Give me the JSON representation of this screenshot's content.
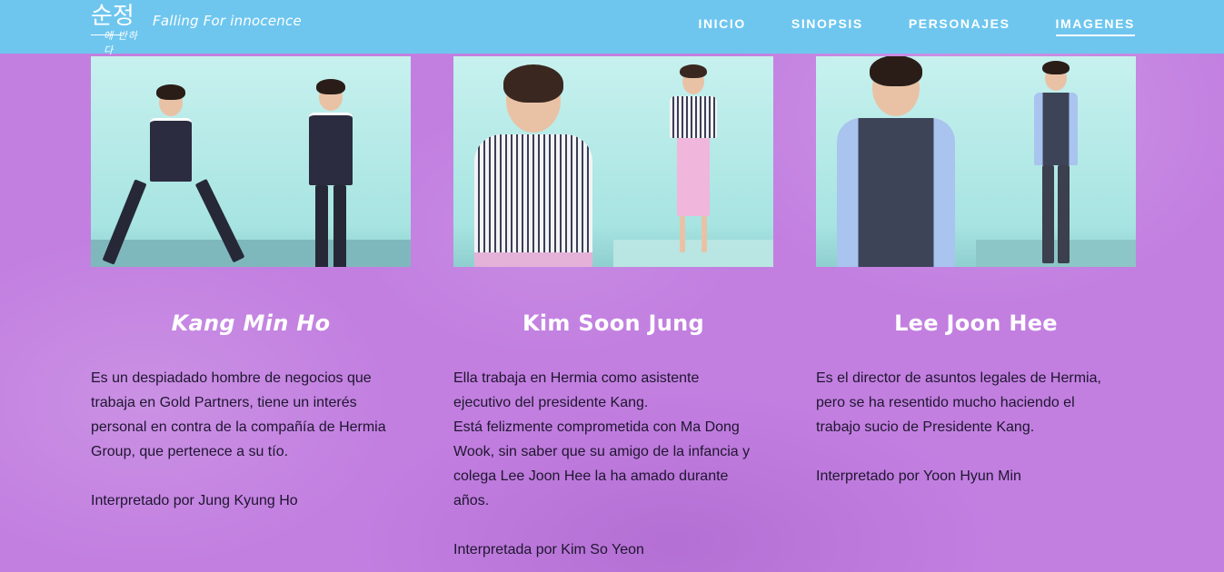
{
  "header": {
    "logo_korean": "순정",
    "logo_korean_small": "에 반하다",
    "logo_title": "Falling For innocence",
    "nav": [
      {
        "label": "INICIO"
      },
      {
        "label": "SINOPSIS"
      },
      {
        "label": "PERSONAJES"
      },
      {
        "label": "IMAGENES"
      }
    ],
    "active_nav": "IMAGENES"
  },
  "characters": [
    {
      "name": "Kang Min Ho",
      "description": [
        "Es un despiadado hombre de negocios que",
        "trabaja en Gold Partners, tiene un interés",
        "personal en contra de la compañía de Hermia",
        "Group, que pertenece a su tío."
      ],
      "actor": "Interpretado por Jung Kyung Ho"
    },
    {
      "name": "Kim Soon Jung",
      "description": [
        "Ella trabaja en Hermia como asistente",
        "ejecutivo del presidente Kang.",
        "Está felizmente comprometida con Ma Dong",
        "Wook, sin saber que su amigo de la infancia y",
        "colega Lee Joon Hee la ha amado durante",
        "años."
      ],
      "actor": "Interpretada por Kim So Yeon"
    },
    {
      "name": "Lee Joon Hee",
      "description": [
        "Es el director de asuntos legales de Hermia,",
        "pero se ha resentido mucho haciendo el",
        "trabajo sucio de Presidente Kang."
      ],
      "actor": "Interpretado por Yoon Hyun Min"
    }
  ],
  "colors": {
    "header_bg": "#6ec6ef",
    "page_bg": "#c27fe0",
    "photo_bg": "#a9e8e6"
  }
}
